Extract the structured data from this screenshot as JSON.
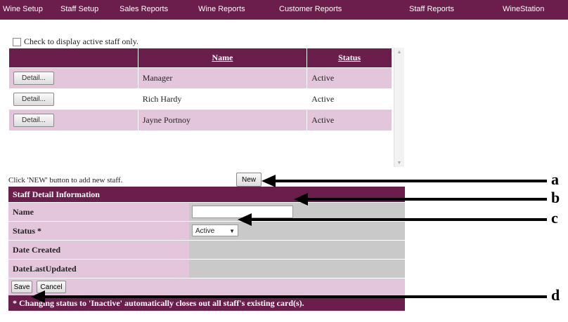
{
  "nav": {
    "items": [
      "Wine Setup",
      "Staff Setup",
      "Sales Reports",
      "Wine Reports",
      "Customer Reports",
      "Staff Reports",
      "WineStation"
    ]
  },
  "filter": {
    "label": "Check to display active staff only.",
    "checked": false
  },
  "staff_table": {
    "headers": [
      "",
      "Name",
      "Status"
    ],
    "detail_label": "Detail...",
    "rows": [
      {
        "name": "Manager",
        "status": "Active"
      },
      {
        "name": "Rich Hardy",
        "status": "Active"
      },
      {
        "name": "Jayne Portnoy",
        "status": "Active"
      }
    ]
  },
  "add_hint": "Click 'NEW' button to add new staff.",
  "new_label": "New",
  "detail_panel": {
    "title": "Staff Detail Information",
    "fields": {
      "name_label": "Name",
      "name_value": "",
      "status_label": "Status *",
      "status_value": "Active",
      "date_created_label": "Date Created",
      "date_updated_label": "DateLastUpdated"
    },
    "save_label": "Save",
    "cancel_label": "Cancel",
    "note": "* Changing status to 'Inactive' automatically closes out all staff's existing card(s)."
  },
  "callouts": [
    "a",
    "b",
    "c",
    "d"
  ],
  "colors": {
    "accent": "#6b1e4c",
    "row_tint": "#e4c6dc",
    "field_bg": "#c9c9c9"
  }
}
